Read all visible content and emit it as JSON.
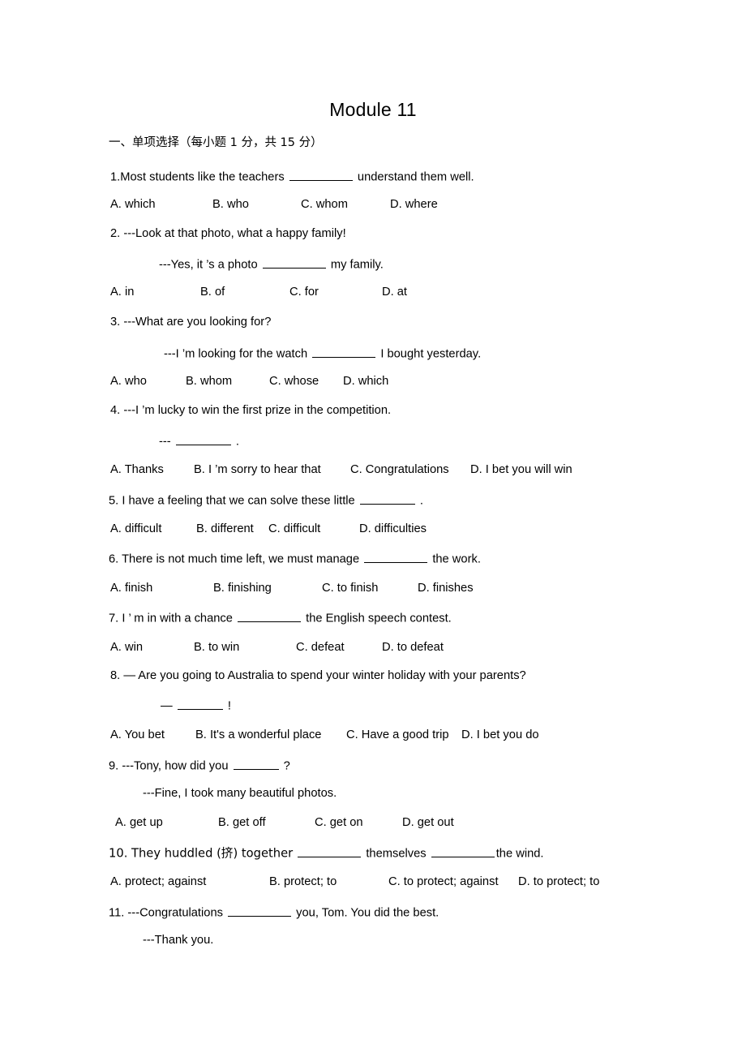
{
  "document": {
    "title": "Module 11",
    "section_heading": "一、单项选择（每小题  1 分，共  15 分）"
  },
  "questions": [
    {
      "number": "1",
      "stem_pre": "1.Most students like the teachers",
      "stem_post": "understand them well.",
      "blank": "long",
      "reply": null,
      "options": [
        "A. which",
        "B. who",
        "C. whom",
        "D. where"
      ],
      "opt_style": "w1"
    },
    {
      "number": "2",
      "stem_pre": "2. ---Look at that photo, what a happy family!",
      "stem_post": "",
      "blank": "none",
      "reply_pre": "---Yes, it ’s a photo",
      "reply_post": "my family.",
      "reply_blank": "long",
      "options": [
        "A. in",
        "B. of",
        "C. for",
        "D. at"
      ],
      "opt_style": "w1"
    },
    {
      "number": "3",
      "stem_pre": "3. ---What are you looking for?",
      "stem_post": "",
      "blank": "none",
      "reply_pre": "---I ’m looking for the watch",
      "reply_post": "I bought yesterday.",
      "reply_blank": "long",
      "options": [
        "A. who",
        "B. whom",
        "C. whose",
        "D. which"
      ],
      "opt_style": "w2"
    },
    {
      "number": "4",
      "stem_pre": "4. ---I ’m lucky to win the first prize in the competition.",
      "stem_post": "",
      "blank": "none",
      "reply_pre": "---",
      "reply_post": ".",
      "reply_blank": "med",
      "options": [
        "A. Thanks",
        "B. I ’m sorry to hear that",
        "C. Congratulations",
        "D. I bet you will win"
      ],
      "opt_style": "w4"
    },
    {
      "number": "5",
      "stem_pre": "5. I have a feeling that we can solve these little",
      "stem_post": ".",
      "blank": "med",
      "reply": null,
      "options": [
        "A. difficult",
        "B. different",
        "C. difficult",
        "D. difficulties"
      ],
      "opt_style": "w3"
    },
    {
      "number": "6",
      "stem_pre": "6. There is not much time left, we must manage",
      "stem_post": "the work.",
      "blank": "long",
      "reply": null,
      "options": [
        "A. finish",
        "B. finishing",
        "C. to finish",
        "D. finishes"
      ],
      "opt_style": "w1"
    },
    {
      "number": "7",
      "stem_pre": "7. I    ’  m in with a chance",
      "stem_post": "the English speech contest.",
      "blank": "long",
      "reply": null,
      "options": [
        "A. win",
        "B. to win",
        "C. defeat",
        "D. to defeat"
      ],
      "opt_style": "w2"
    },
    {
      "number": "8",
      "stem_pre": "8.  — Are you going to Australia to spend your winter holiday with your parents?",
      "stem_post": "",
      "blank": "none",
      "reply_pre": "—",
      "reply_post": "!",
      "reply_blank": "short",
      "options": [
        "A. You bet",
        "B. It's a wonderful place",
        "C. Have a good trip",
        "D. I bet you do"
      ],
      "opt_style": "w5"
    },
    {
      "number": "9",
      "stem_pre": "9. ---Tony, how did you",
      "stem_post": "?",
      "blank": "short",
      "reply_pre": "---Fine, I took many beautiful photos.",
      "reply_post": "",
      "reply_blank": "none",
      "options": [
        "A. get up",
        "B. get off",
        "C. get on",
        "D. get out"
      ],
      "opt_style": "w1"
    },
    {
      "number": "10",
      "stem_pre": "10. They huddled (挤) together",
      "stem_mid": "themselves",
      "stem_post": "the wind.",
      "blank": "long",
      "blank2": "long",
      "reply": null,
      "options": [
        "A. protect; against",
        "B. protect; to",
        "C. to protect; against",
        "D. to protect; to"
      ],
      "opt_style": "w6"
    },
    {
      "number": "11",
      "stem_pre": "11. ---Congratulations",
      "stem_post": "you, Tom. You did the best.",
      "blank": "long",
      "reply_pre": "---Thank you.",
      "reply_post": "",
      "reply_blank": "none",
      "options": [],
      "opt_style": "w1"
    }
  ]
}
